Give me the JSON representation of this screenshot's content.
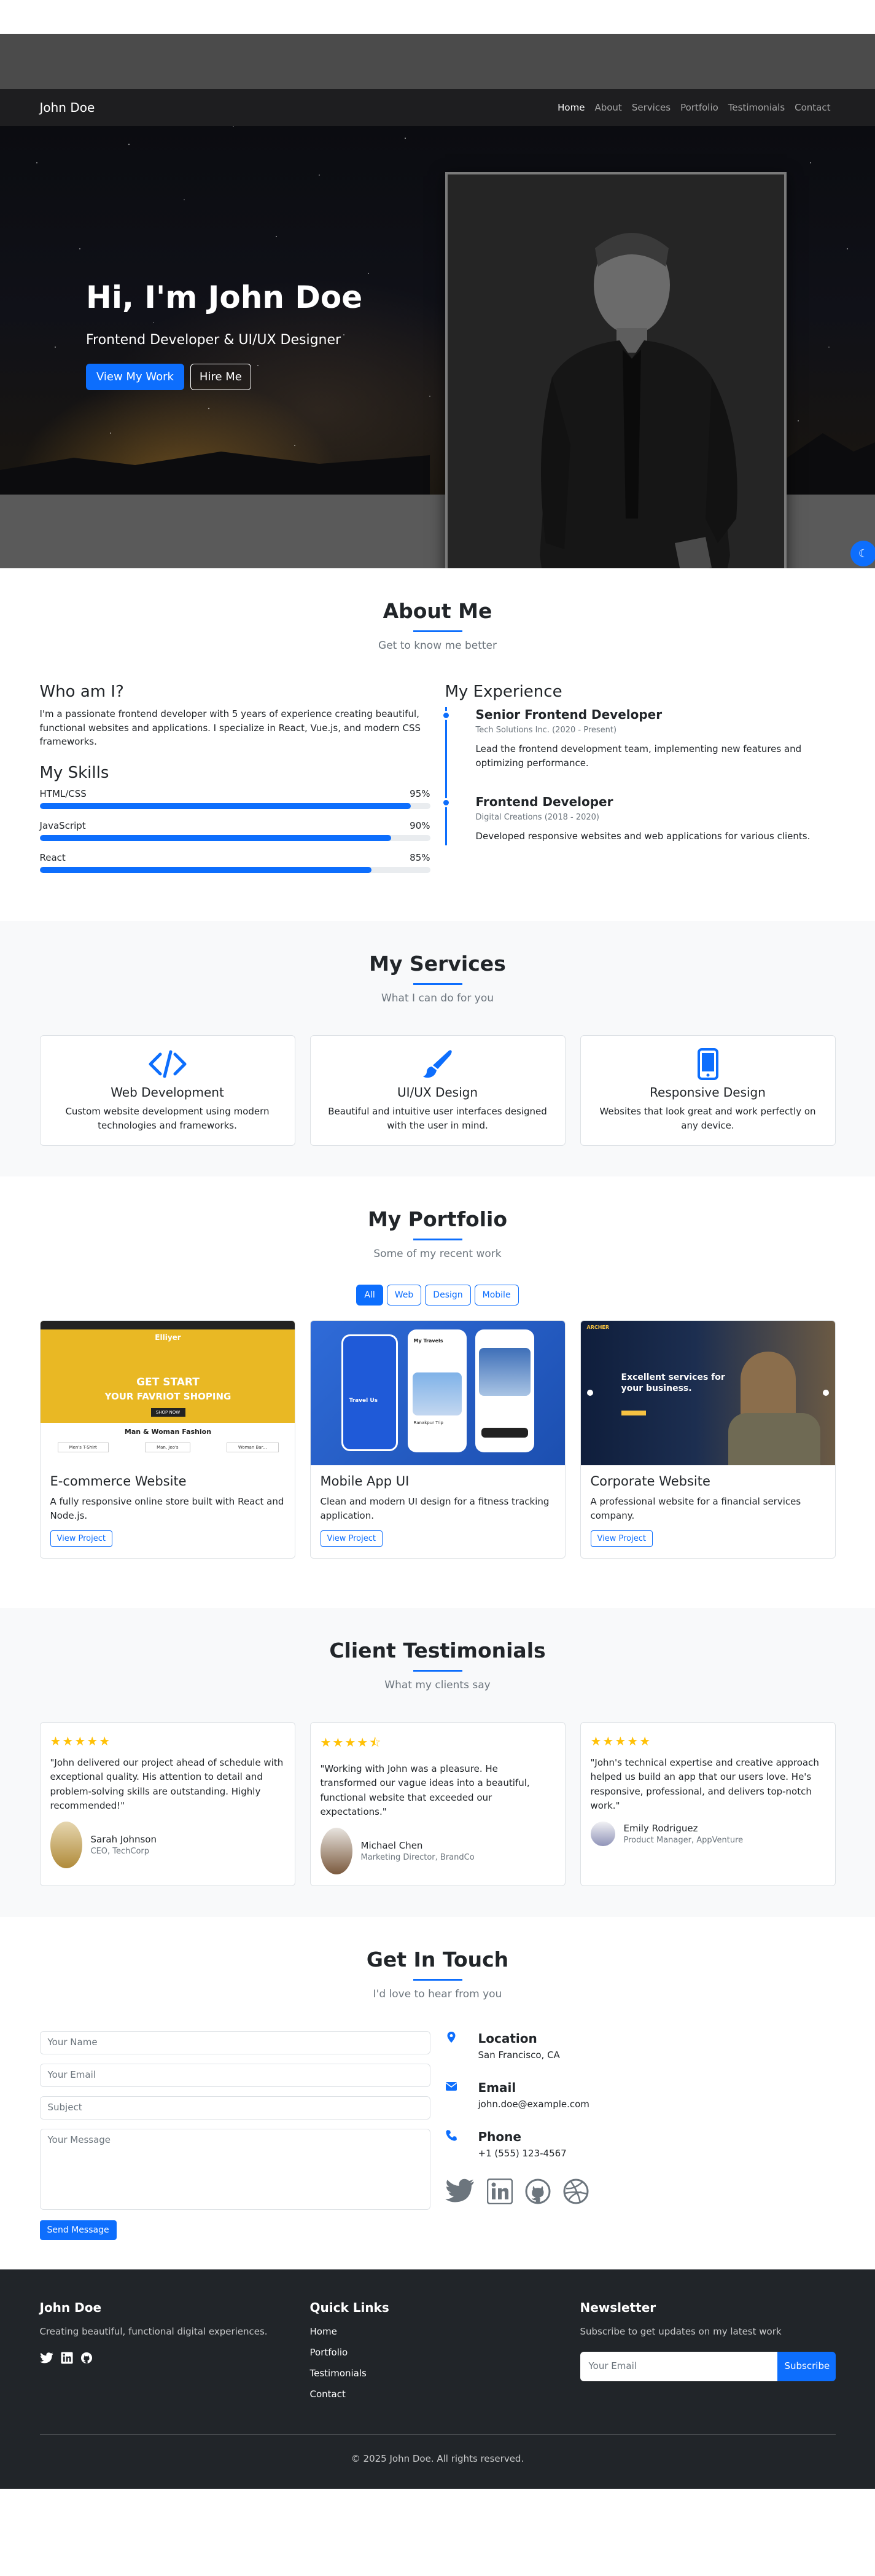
{
  "nav": {
    "brand": "John Doe",
    "links": [
      "Home",
      "About",
      "Services",
      "Portfolio",
      "Testimonials",
      "Contact"
    ],
    "active": "Home"
  },
  "hero": {
    "title": "Hi, I'm John Doe",
    "subtitle": "Frontend Developer & UI/UX Designer",
    "primary_cta": "View My Work",
    "secondary_cta": "Hire Me"
  },
  "theme_toggle_icon": "moon-icon",
  "about": {
    "title": "About Me",
    "subtitle": "Get to know me better",
    "who_heading": "Who am I?",
    "bio": "I'm a passionate frontend developer with 5 years of experience creating beautiful, functional websites and applications. I specialize in React, Vue.js, and modern CSS frameworks.",
    "skills_heading": "My Skills",
    "skills": [
      {
        "name": "HTML/CSS",
        "percent_label": "95%",
        "level": 0.95
      },
      {
        "name": "JavaScript",
        "percent_label": "90%",
        "level": 0.9
      },
      {
        "name": "React",
        "percent_label": "85%",
        "level": 0.85
      }
    ],
    "experience_heading": "My Experience",
    "experience": [
      {
        "role": "Senior Frontend Developer",
        "meta": "Tech Solutions Inc. (2020 - Present)",
        "desc": "Lead the frontend development team, implementing new features and optimizing performance."
      },
      {
        "role": "Frontend Developer",
        "meta": "Digital Creations (2018 - 2020)",
        "desc": "Developed responsive websites and web applications for various clients."
      }
    ]
  },
  "services": {
    "title": "My Services",
    "subtitle": "What I can do for you",
    "items": [
      {
        "icon": "code-icon",
        "title": "Web Development",
        "desc": "Custom website development using modern technologies and frameworks."
      },
      {
        "icon": "paint-brush-icon",
        "title": "UI/UX Design",
        "desc": "Beautiful and intuitive user interfaces designed with the user in mind."
      },
      {
        "icon": "mobile-icon",
        "title": "Responsive Design",
        "desc": "Websites that look great and work perfectly on any device."
      }
    ]
  },
  "portfolio": {
    "title": "My Portfolio",
    "subtitle": "Some of my recent work",
    "filters": [
      "All",
      "Web",
      "Design",
      "Mobile"
    ],
    "active_filter": "All",
    "items": [
      {
        "title": "E-commerce Website",
        "desc": "A fully responsive online store built with React and Node.js.",
        "cta": "View Project",
        "thumb": {
          "logo": "Elliyer",
          "banner_line1": "GET START",
          "banner_line2": "YOUR FAVRIOT SHOPING",
          "banner_button": "SHOP NOW",
          "section_title": "Man & Woman Fashion",
          "tags": [
            "Men's T-Shirt",
            "Man, Jeo's",
            "Woman Bar..."
          ]
        }
      },
      {
        "title": "Mobile App UI",
        "desc": "Clean and modern UI design for a fitness tracking application.",
        "cta": "View Project",
        "thumb": {
          "screen_text": "Travel Us",
          "card_title": "My Travels",
          "trip_label": "Ranakpur Trip"
        }
      },
      {
        "title": "Corporate Website",
        "desc": "A professional website for a financial services company.",
        "cta": "View Project",
        "thumb": {
          "logo": "ARCHER",
          "headline_line1": "Excellent services for",
          "headline_line2": "your business."
        }
      }
    ]
  },
  "testimonials": {
    "title": "Client Testimonials",
    "subtitle": "What my clients say",
    "items": [
      {
        "rating": 5,
        "stars": "★★★★★",
        "quote": "\"John delivered our project ahead of schedule with exceptional quality. His attention to detail and problem-solving skills are outstanding. Highly recommended!\"",
        "name": "Sarah Johnson",
        "role": "CEO, TechCorp"
      },
      {
        "rating": 4.5,
        "stars": "★★★★⯪",
        "quote": "\"Working with John was a pleasure. He transformed our vague ideas into a beautiful, functional website that exceeded our expectations.\"",
        "name": "Michael Chen",
        "role": "Marketing Director, BrandCo"
      },
      {
        "rating": 5,
        "stars": "★★★★★",
        "quote": "\"John's technical expertise and creative approach helped us build an app that our users love. He's responsive, professional, and delivers top-notch work.\"",
        "name": "Emily Rodriguez",
        "role": "Product Manager, AppVenture"
      }
    ]
  },
  "contact": {
    "title": "Get In Touch",
    "subtitle": "I'd love to hear from you",
    "form": {
      "name_placeholder": "Your Name",
      "email_placeholder": "Your Email",
      "subject_placeholder": "Subject",
      "message_placeholder": "Your Message",
      "submit": "Send Message"
    },
    "info": [
      {
        "icon": "map-marker-icon",
        "label": "Location",
        "value": "San Francisco, CA"
      },
      {
        "icon": "envelope-icon",
        "label": "Email",
        "value": "john.doe@example.com"
      },
      {
        "icon": "phone-icon",
        "label": "Phone",
        "value": "+1 (555) 123-4567"
      }
    ],
    "socials": [
      "twitter-icon",
      "linkedin-icon",
      "github-icon",
      "dribbble-icon"
    ]
  },
  "footer": {
    "brand": "John Doe",
    "tagline": "Creating beautiful, functional digital experiences.",
    "socials": [
      "twitter-icon",
      "linkedin-icon",
      "github-icon"
    ],
    "links_heading": "Quick Links",
    "links": [
      "Home",
      "Portfolio",
      "Testimonials",
      "Contact"
    ],
    "newsletter_heading": "Newsletter",
    "newsletter_text": "Subscribe to get updates on my latest work",
    "newsletter_placeholder": "Your Email",
    "newsletter_button": "Subscribe",
    "copyright": "© 2025 John Doe. All rights reserved."
  },
  "colors": {
    "primary": "#0d6efd",
    "dark": "#212529",
    "light_bg": "#f8f9fa",
    "star": "#ffc107"
  }
}
